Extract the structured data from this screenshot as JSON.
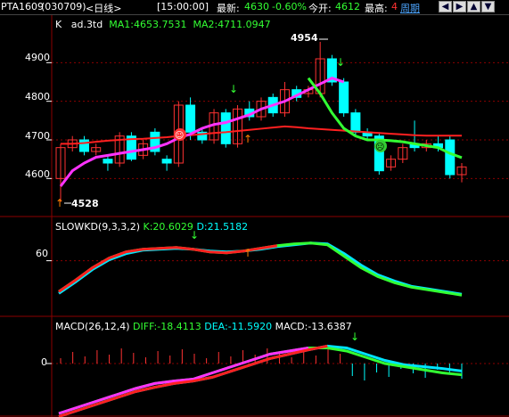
{
  "header": {
    "symbol": "PTA1609",
    "code": "(030709)",
    "period": "<日线>",
    "time": "[15:00:00]",
    "latest_label": "最新:",
    "latest_value": "4630",
    "change_pct": "-0.60%",
    "open_label": "今开:",
    "open_value": "4612",
    "high_label": "最高:",
    "high_value": "4",
    "cycle_label": "周期",
    "nav_icons": [
      "arrow-left-icon",
      "arrow-right-icon",
      "arrow-up-icon",
      "arrow-down-icon"
    ]
  },
  "main_panel": {
    "title_k": "K",
    "title_indicator": "ad.3td",
    "ma1_text": "MA1:4653.7531",
    "ma2_text": "MA2:4711.0947",
    "y_ticks": [
      "4900",
      "4800",
      "4700",
      "4600"
    ],
    "high_mark": "4954",
    "low_mark": "4528"
  },
  "kd_panel": {
    "title": "SLOWKD(9,3,3,2)",
    "k_text": "K:20.6029",
    "d_text": "D:21.5182",
    "y_tick": "60"
  },
  "macd_panel": {
    "title": "MACD(26,12,4)",
    "diff_text": "DIFF:-18.4113",
    "dea_text": "DEA:-11.5920",
    "macd_text": "MACD:-13.6387",
    "y_tick": "0"
  },
  "colors": {
    "up": "#ff3232",
    "down": "#00ffff",
    "ma1": "#ff33ff",
    "ma2": "#ff2020",
    "green_line": "#33ff33",
    "grid": "#8b0000",
    "axis_text": "#ffffff"
  },
  "chart_data": [
    {
      "type": "candlestick",
      "ylim": [
        4520,
        4970
      ],
      "candles": [
        [
          4600,
          4680,
          4540,
          4690
        ],
        [
          4680,
          4700,
          4670,
          4710
        ],
        [
          4700,
          4670,
          4660,
          4710
        ],
        [
          4670,
          4680,
          4660,
          4690
        ],
        [
          4650,
          4640,
          4620,
          4660
        ],
        [
          4640,
          4710,
          4630,
          4720
        ],
        [
          4710,
          4650,
          4645,
          4720
        ],
        [
          4660,
          4690,
          4650,
          4700
        ],
        [
          4720,
          4670,
          4660,
          4730
        ],
        [
          4650,
          4640,
          4620,
          4660
        ],
        [
          4640,
          4790,
          4630,
          4800
        ],
        [
          4790,
          4720,
          4700,
          4810
        ],
        [
          4720,
          4700,
          4690,
          4730
        ],
        [
          4700,
          4770,
          4690,
          4780
        ],
        [
          4770,
          4690,
          4680,
          4780
        ],
        [
          4690,
          4780,
          4680,
          4790
        ],
        [
          4780,
          4760,
          4750,
          4800
        ],
        [
          4760,
          4800,
          4750,
          4810
        ],
        [
          4810,
          4770,
          4760,
          4820
        ],
        [
          4770,
          4830,
          4760,
          4850
        ],
        [
          4830,
          4810,
          4800,
          4840
        ],
        [
          4820,
          4830,
          4810,
          4840
        ],
        [
          4820,
          4910,
          4810,
          4954
        ],
        [
          4910,
          4850,
          4840,
          4920
        ],
        [
          4850,
          4770,
          4760,
          4860
        ],
        [
          4770,
          4720,
          4710,
          4780
        ],
        [
          4720,
          4710,
          4700,
          4730
        ],
        [
          4710,
          4620,
          4610,
          4720
        ],
        [
          4630,
          4650,
          4620,
          4660
        ],
        [
          4650,
          4680,
          4640,
          4690
        ],
        [
          4690,
          4680,
          4670,
          4750
        ],
        [
          4680,
          4690,
          4670,
          4700
        ],
        [
          4690,
          4680,
          4670,
          4710
        ],
        [
          4700,
          4610,
          4600,
          4710
        ],
        [
          4610,
          4630,
          4590,
          4640
        ]
      ],
      "ma1": [
        4580,
        4620,
        4640,
        4655,
        4660,
        4665,
        4670,
        4675,
        4680,
        4690,
        4705,
        4715,
        4730,
        4740,
        4745,
        4755,
        4765,
        4780,
        4790,
        4800,
        4815,
        4830,
        4845,
        4860,
        4850
      ],
      "ma2": [
        4690,
        4690,
        4692,
        4695,
        4698,
        4700,
        4702,
        4703,
        4705,
        4707,
        4710,
        4712,
        4715,
        4718,
        4720,
        4723,
        4726,
        4729,
        4732,
        4735,
        4733,
        4730,
        4728,
        4726,
        4724,
        4722,
        4720,
        4718,
        4716,
        4714,
        4712,
        4711,
        4711,
        4711,
        4711
      ],
      "green_ma": [
        4860,
        4820,
        4770,
        4730,
        4710,
        4700,
        4700,
        4698,
        4695,
        4690,
        4685,
        4680,
        4665,
        4654
      ]
    },
    {
      "type": "line",
      "series": [
        {
          "name": "K",
          "values": [
            25,
            38,
            52,
            63,
            70,
            73,
            74,
            75,
            73,
            70,
            69,
            71,
            74,
            77,
            79,
            80,
            78,
            65,
            52,
            42,
            35,
            30,
            27,
            24,
            21
          ]
        },
        {
          "name": "D",
          "values": [
            23,
            36,
            50,
            61,
            68,
            72,
            73,
            74,
            73,
            71,
            70,
            71,
            73,
            76,
            78,
            80,
            79,
            68,
            55,
            44,
            37,
            31,
            28,
            25,
            22
          ]
        }
      ]
    },
    {
      "type": "line",
      "series": [
        {
          "name": "DIFF",
          "values": [
            -80,
            -70,
            -60,
            -50,
            -40,
            -32,
            -28,
            -25,
            -15,
            -5,
            5,
            15,
            20,
            25,
            25,
            20,
            10,
            0,
            -5,
            -10,
            -15,
            -18
          ]
        },
        {
          "name": "DEA",
          "values": [
            -85,
            -75,
            -65,
            -55,
            -45,
            -38,
            -32,
            -28,
            -22,
            -12,
            -2,
            8,
            15,
            22,
            28,
            25,
            15,
            5,
            -2,
            -5,
            -8,
            -12
          ]
        }
      ]
    }
  ]
}
